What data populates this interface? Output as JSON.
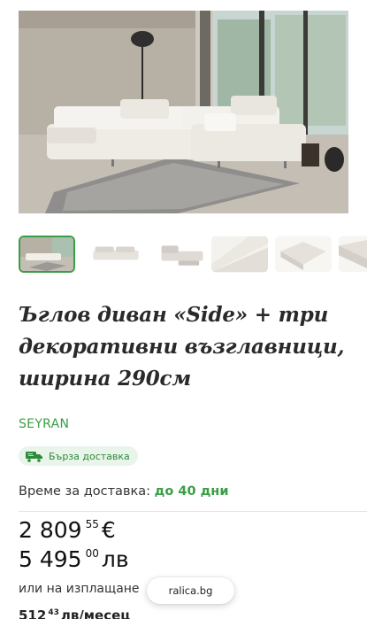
{
  "product": {
    "title_lines": [
      "Ъглов диван «Side» + три",
      "декоративни възглавници,",
      "ширина 290см"
    ],
    "brand": "SEYRAN",
    "fast_delivery_badge": "Бърза доставка",
    "delivery_label": "Време за доставка:",
    "delivery_value": "до 40 дни",
    "price_eur": {
      "whole": "2 809",
      "fraction": "55",
      "currency": "€"
    },
    "price_bgn": {
      "whole": "5 495",
      "fraction": "00",
      "currency": "лв"
    },
    "installment_label": "или на изплащане",
    "installment_price": {
      "whole": "512",
      "fraction": "43",
      "unit": "лв/месец"
    }
  },
  "gallery": {
    "thumbnails": [
      "sofa-room-photo",
      "sofa-side-view",
      "sofa-chaise-view",
      "cushion-closeup",
      "corner-closeup",
      "armrest-closeup"
    ],
    "active_index": 0
  },
  "browser": {
    "url": "ralica.bg"
  },
  "colors": {
    "accent": "#3a9e46",
    "badge_bg": "#e9f5ea"
  }
}
